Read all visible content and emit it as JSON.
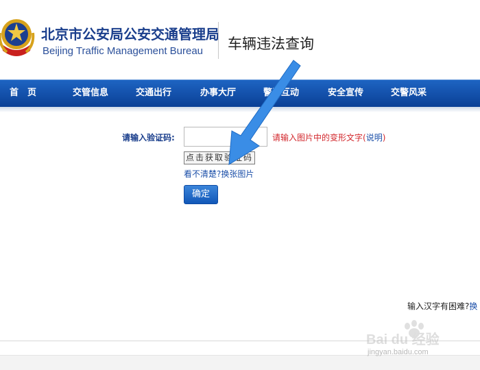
{
  "header": {
    "brand_cn": "北京市公安局公安交通管理局",
    "brand_en": "Beijing Traffic Management Bureau",
    "sub_title": "车辆违法查询"
  },
  "nav": {
    "items": [
      "首　页",
      "交管信息",
      "交通出行",
      "办事大厅",
      "警民互动",
      "安全宣传",
      "交警风采"
    ]
  },
  "form": {
    "label": "请输入验证码:",
    "input_value": "",
    "hint_text": "请输入图片中的变形文字",
    "hint_open": "(",
    "hint_link": "说明",
    "hint_close": ")",
    "captcha_text": "点击获取验证码",
    "refresh_question": "看不清楚?",
    "refresh_link": "换张图片",
    "confirm_label": "确定"
  },
  "help": {
    "text": "输入汉字有困难?",
    "link": "换"
  },
  "watermark": {
    "brand": "Bai du 经验",
    "url": "jingyan.baidu.com"
  },
  "colors": {
    "nav_top": "#1e64c2",
    "nav_bottom": "#0a3f95",
    "brand_blue": "#1a3e8c",
    "hint_red": "#d2262b",
    "link_blue": "#1a4ea8",
    "arrow_blue": "#3a8de6"
  }
}
